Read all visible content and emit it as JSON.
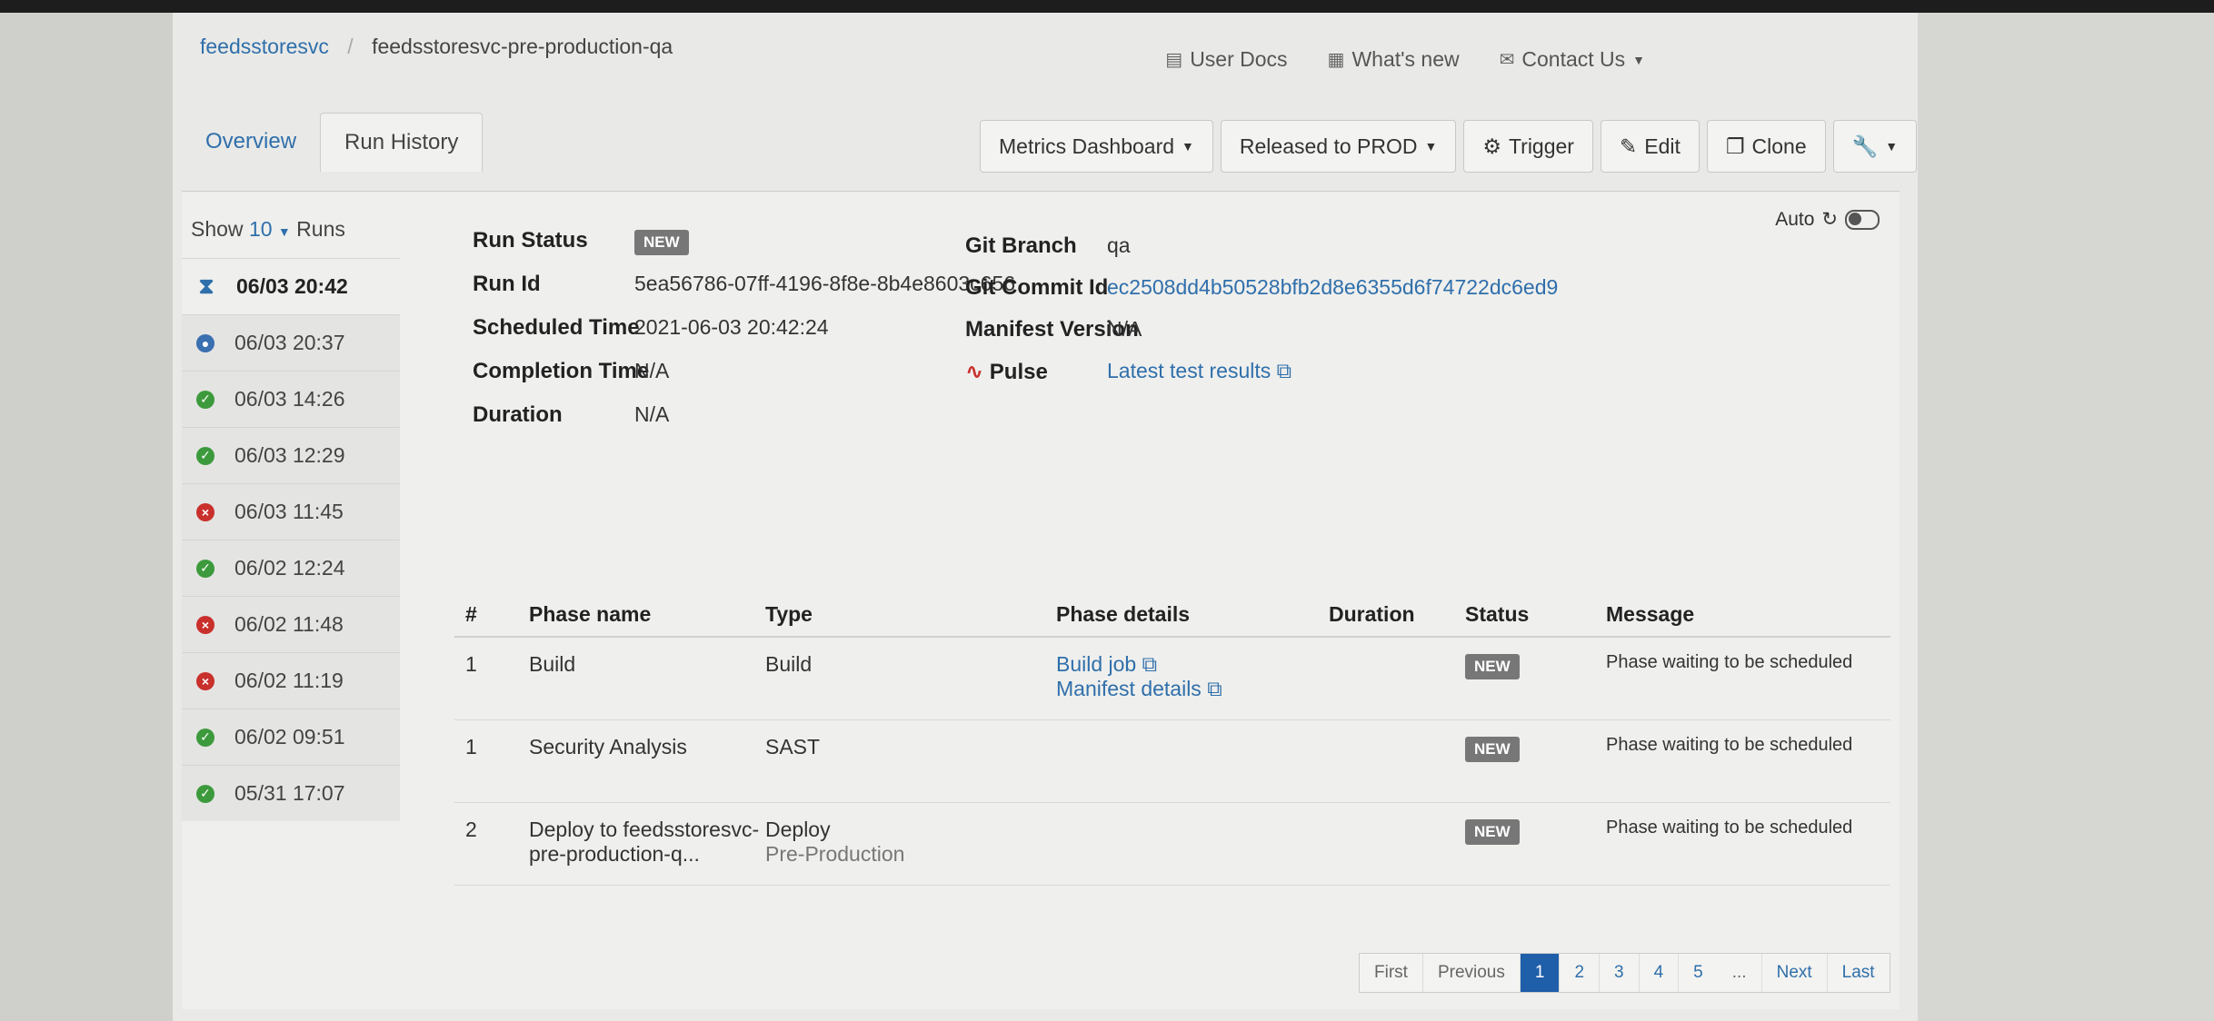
{
  "breadcrumb": {
    "service": "feedsstoresvc",
    "pipeline": "feedsstoresvc-pre-production-qa"
  },
  "toplinks": {
    "user_docs": "User Docs",
    "whats_new": "What's new",
    "contact_us": "Contact Us"
  },
  "tabs": [
    {
      "label": "Overview"
    },
    {
      "label": "Run History"
    }
  ],
  "actions": {
    "metrics": "Metrics Dashboard",
    "released": "Released to PROD",
    "trigger": "Trigger",
    "edit": "Edit",
    "clone": "Clone"
  },
  "runs": {
    "show_label": "Show",
    "count": "10",
    "runs_label": "Runs",
    "items": [
      {
        "time": "06/03 20:42",
        "status": "waiting"
      },
      {
        "time": "06/03 20:37",
        "status": "running"
      },
      {
        "time": "06/03 14:26",
        "status": "success"
      },
      {
        "time": "06/03 12:29",
        "status": "success"
      },
      {
        "time": "06/03 11:45",
        "status": "failed"
      },
      {
        "time": "06/02 12:24",
        "status": "success"
      },
      {
        "time": "06/02 11:48",
        "status": "failed"
      },
      {
        "time": "06/02 11:19",
        "status": "failed"
      },
      {
        "time": "06/02 09:51",
        "status": "success"
      },
      {
        "time": "05/31 17:07",
        "status": "success"
      }
    ]
  },
  "summary": {
    "run_status_label": "Run Status",
    "run_status": "NEW",
    "run_id_label": "Run Id",
    "run_id": "5ea56786-07ff-4196-8f8e-8b4e8603c656",
    "scheduled_label": "Scheduled Time",
    "scheduled": "2021-06-03 20:42:24",
    "completion_label": "Completion Time",
    "completion": "N/A",
    "duration_label": "Duration",
    "duration": "N/A",
    "git_branch_label": "Git Branch",
    "git_branch": "qa",
    "git_commit_label": "Git Commit Id",
    "git_commit": "ec2508dd4b50528bfb2d8e6355d6f74722dc6ed9",
    "manifest_label": "Manifest Version",
    "manifest": "N/A",
    "pulse_label": "Pulse",
    "pulse_link": "Latest test results",
    "auto_label": "Auto"
  },
  "phases": {
    "headers": [
      "#",
      "Phase name",
      "Type",
      "Phase details",
      "Duration",
      "Status",
      "Message"
    ],
    "rows": [
      {
        "num": "1",
        "name": "Build",
        "type": "Build",
        "subtype": "",
        "details": [
          "Build job",
          "Manifest details"
        ],
        "duration": "",
        "status": "NEW",
        "message": "Phase waiting to be scheduled"
      },
      {
        "num": "1",
        "name": "Security Analysis",
        "type": "SAST",
        "subtype": "",
        "details": [],
        "duration": "",
        "status": "NEW",
        "message": "Phase waiting to be scheduled"
      },
      {
        "num": "2",
        "name": "Deploy to feedsstoresvc-pre-production-q...",
        "type": "Deploy",
        "subtype": "Pre-Production",
        "details": [],
        "duration": "",
        "status": "NEW",
        "message": "Phase waiting to be scheduled"
      }
    ]
  },
  "pager": {
    "first": "First",
    "previous": "Previous",
    "pages": [
      "1",
      "2",
      "3",
      "4",
      "5"
    ],
    "ellipsis": "...",
    "next": "Next",
    "last": "Last",
    "current": "1"
  }
}
